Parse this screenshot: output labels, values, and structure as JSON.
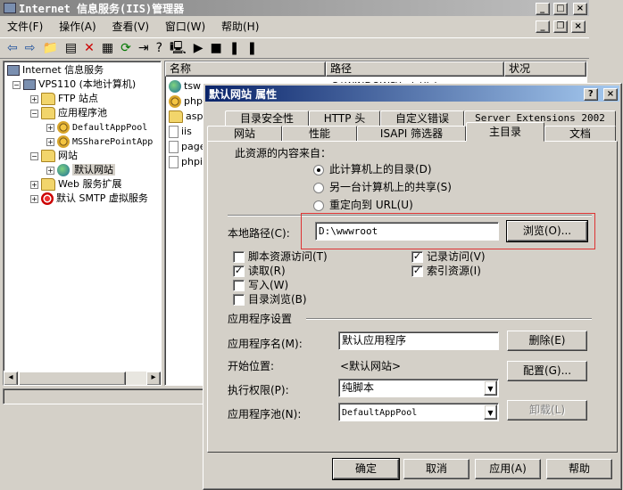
{
  "main_window": {
    "title": "Internet 信息服务(IIS)管理器",
    "menu": [
      "文件(F)",
      "操作(A)",
      "查看(V)",
      "窗口(W)",
      "帮助(H)"
    ]
  },
  "tree": {
    "root": "Internet 信息服务",
    "server": "VPS110 (本地计算机)",
    "ftp": "FTP 站点",
    "app_pools": "应用程序池",
    "pool_default": "DefaultAppPool",
    "pool_sharepoint": "MSSharePointApp",
    "websites": "网站",
    "default_site": "默认网站",
    "web_ext": "Web 服务扩展",
    "smtp": "默认 SMTP 虚拟服务"
  },
  "list": {
    "columns": [
      "名称",
      "路径",
      "状况"
    ],
    "items": [
      "tsw",
      "phpM",
      "aspn",
      "iis",
      "page",
      "phpi"
    ],
    "first_path": "C:\\WINDOWS\\help\\iish"
  },
  "dialog": {
    "title": "默认网站 属性",
    "tabs_back": [
      "目录安全性",
      "HTTP 头",
      "自定义错误",
      "Server Extensions 2002"
    ],
    "tabs_front": [
      "网站",
      "性能",
      "ISAPI 筛选器",
      "主目录",
      "文档"
    ],
    "content_source_label": "此资源的内容来自：",
    "radio1": "此计算机上的目录(D)",
    "radio2": "另一台计算机上的共享(S)",
    "radio3": "重定向到 URL(U)",
    "local_path_label": "本地路径(C):",
    "local_path_value": "D:\\wwwroot",
    "browse": "浏览(O)...",
    "chk_script": "脚本资源访问(T)",
    "chk_read": "读取(R)",
    "chk_write": "写入(W)",
    "chk_dirbrowse": "目录浏览(B)",
    "chk_log": "记录访问(V)",
    "chk_index": "索引资源(I)",
    "app_settings": "应用程序设置",
    "app_name_label": "应用程序名(M):",
    "app_name_value": "默认应用程序",
    "remove": "删除(E)",
    "start_point_label": "开始位置:",
    "start_point_value": "<默认网站>",
    "config": "配置(G)...",
    "exec_perm_label": "执行权限(P):",
    "exec_perm_value": "纯脚本",
    "app_pool_label": "应用程序池(N):",
    "app_pool_value": "DefaultAppPool",
    "unload": "卸载(L)",
    "ok": "确定",
    "cancel": "取消",
    "apply": "应用(A)",
    "help": "帮助"
  },
  "colors": {
    "title_active": "#0a246a",
    "highlight": "#d33",
    "face": "#d4d0c8"
  }
}
